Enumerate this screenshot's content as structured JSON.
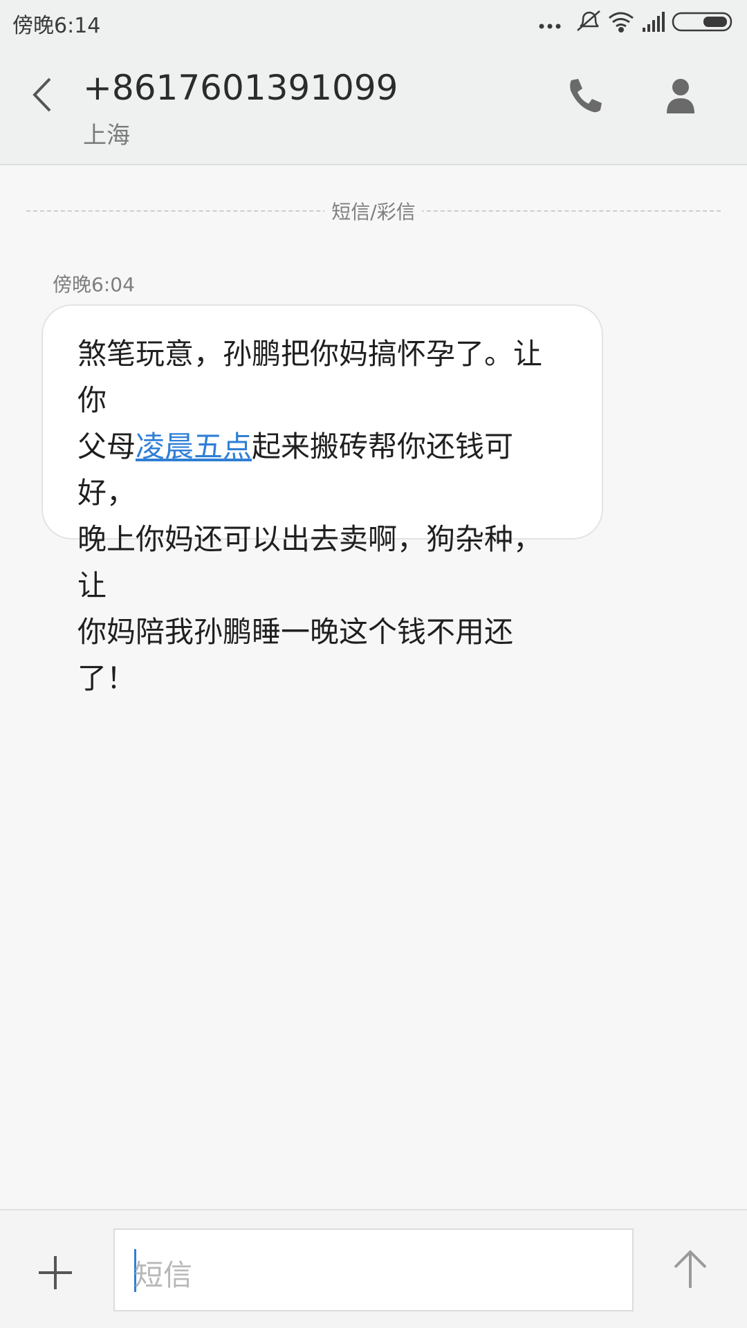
{
  "status_bar": {
    "time": "傍晚6:14",
    "icons": [
      "more-dots-icon",
      "silent-bell-icon",
      "wifi-icon",
      "signal-icon",
      "battery-icon"
    ]
  },
  "header": {
    "title": "+8617601391099",
    "subtitle": "上海",
    "icons": [
      "back-arrow-icon",
      "phone-icon",
      "person-icon"
    ]
  },
  "thread": {
    "divider_label": "短信/彩信",
    "messages": [
      {
        "time": "傍晚6:04",
        "text_parts": {
          "line1": "煞笔玩意，孙鹏把你妈搞怀孕了。让你",
          "pre_link": "父母",
          "link": "凌晨五点",
          "post_link": "起来搬砖帮你还钱可好，",
          "line3": "晚上你妈还可以出去卖啊，狗杂种，让",
          "line4": "你妈陪我孙鹏睡一晚这个钱不用还了！"
        }
      }
    ]
  },
  "composer": {
    "placeholder": "短信",
    "icons": [
      "plus-icon",
      "send-arrow-icon"
    ]
  },
  "colors": {
    "header_bg": "#eff0f0",
    "page_bg": "#f7f7f7",
    "link": "#2f7fd5",
    "bubble_bg": "#ffffff"
  }
}
